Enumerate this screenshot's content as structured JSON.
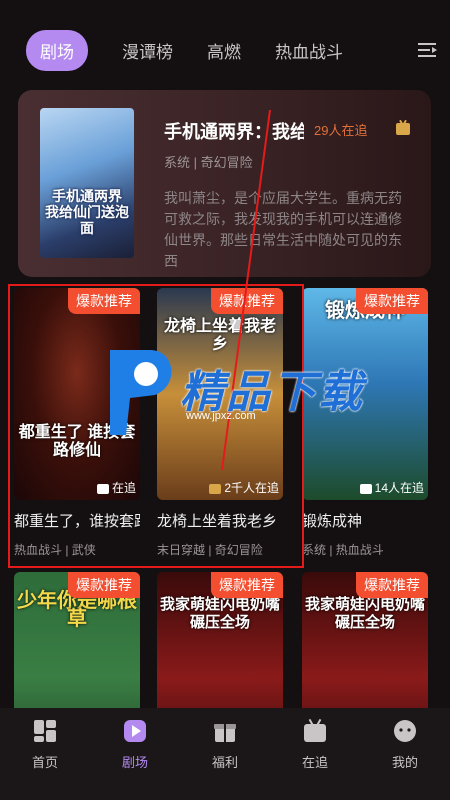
{
  "tabs": [
    {
      "label": "剧场",
      "active": true
    },
    {
      "label": "漫谭榜"
    },
    {
      "label": "高燃"
    },
    {
      "label": "热血战斗"
    }
  ],
  "featured": {
    "cover_text": "手机通两界 我给仙门送泡面",
    "title": "手机通两界：我给仙门送泡面",
    "follow": "29人在追",
    "tags": "系统 | 奇幻冒险",
    "description": "我叫萧尘，是个应届大学生。重病无药可救之际，我发现我的手机可以连通修仙世界。那些日常生活中随处可见的东西"
  },
  "cards": [
    {
      "badge": "爆款推荐",
      "cover_text": "都重生了 谁按套路修仙",
      "count": "在追",
      "name": "都重生了，谁按套路修仙",
      "meta": "热血战斗 | 武侠"
    },
    {
      "badge": "爆款推荐",
      "cover_text": "龙椅上坐着我老乡",
      "count": "2千人在追",
      "name": "龙椅上坐着我老乡",
      "meta": "末日穿越 | 奇幻冒险"
    },
    {
      "badge": "爆款推荐",
      "cover_text": "锻炼成神",
      "count": "14人在追",
      "name": "锻炼成神",
      "meta": "系统 | 热血战斗"
    },
    {
      "badge": "爆款推荐",
      "cover_text": "少年你是哪根草",
      "count": "",
      "name": "",
      "meta": ""
    },
    {
      "badge": "爆款推荐",
      "cover_text": "我家萌娃闪电奶嘴 碾压全场",
      "count": "",
      "name": "",
      "meta": ""
    },
    {
      "badge": "爆款推荐",
      "cover_text": "我家萌娃闪电奶嘴 碾压全场",
      "count": "",
      "name": "",
      "meta": ""
    }
  ],
  "watermark": {
    "text": "精品下载",
    "url": "www.jpxz.com"
  },
  "bottom_nav": [
    {
      "label": "首页",
      "icon": "home-grid-icon"
    },
    {
      "label": "剧场",
      "icon": "play-icon",
      "active": true
    },
    {
      "label": "福利",
      "icon": "gift-icon"
    },
    {
      "label": "在追",
      "icon": "follow-tv-icon"
    },
    {
      "label": "我的",
      "icon": "profile-icon"
    }
  ],
  "colors": {
    "accent": "#b48af1",
    "badge": "#f24e2f",
    "follow": "#e0703a",
    "background": "#141012"
  }
}
